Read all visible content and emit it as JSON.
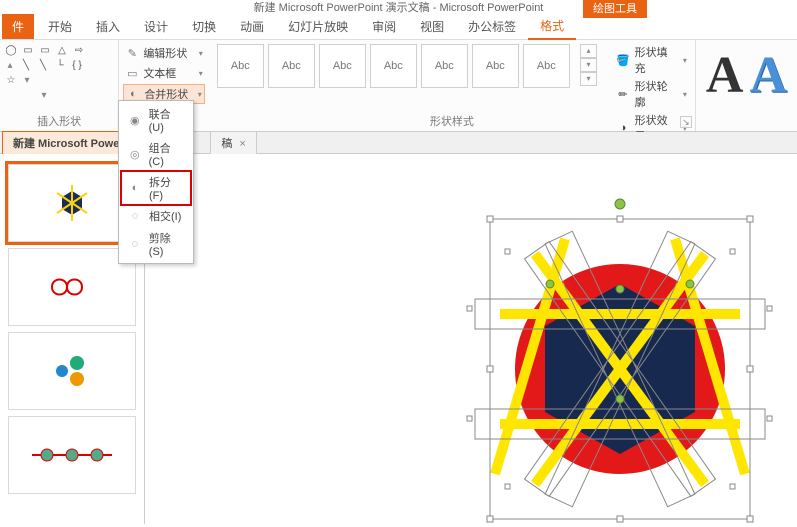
{
  "titlebar": {
    "title": "新建 Microsoft PowerPoint 演示文稿 - Microsoft PowerPoint",
    "context_tool": "绘图工具"
  },
  "tabs": {
    "file": "件",
    "items": [
      "开始",
      "插入",
      "设计",
      "切换",
      "动画",
      "幻灯片放映",
      "审阅",
      "视图",
      "办公标签",
      "格式"
    ]
  },
  "ribbon": {
    "edit_shape": "编辑形状",
    "text_box": "文本框",
    "merge_shapes": "合并形状",
    "insert_shapes_label": "插入形状",
    "shape_styles_label": "形状样式",
    "swatch_label": "Abc",
    "shape_fill": "形状填充",
    "shape_outline": "形状轮廓",
    "shape_effects": "形状效果"
  },
  "merge_menu": {
    "union": "联合(U)",
    "combine": "组合(C)",
    "fragment": "拆分(F)",
    "intersect": "相交(I)",
    "subtract": "剪除(S)"
  },
  "doc_tabs": {
    "active": "新建 Microsoft Powe",
    "inactive": "稿"
  }
}
